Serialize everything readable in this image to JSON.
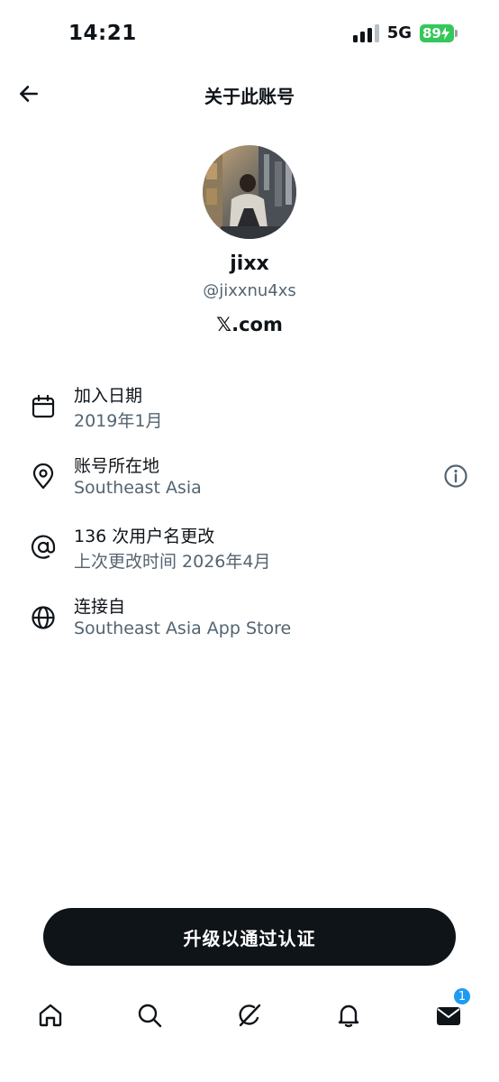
{
  "status_bar": {
    "time": "14:21",
    "network": "5G",
    "battery": "89"
  },
  "header": {
    "title": "关于此账号",
    "back_icon": "arrow-left-icon"
  },
  "profile": {
    "display_name": "jixx",
    "handle": "@jixxnu4xs",
    "site": "𝕏.com"
  },
  "info": [
    {
      "icon": "calendar-icon",
      "label": "加入日期",
      "value": "2019年1月"
    },
    {
      "icon": "location-pin-icon",
      "label": "账号所在地",
      "value": "Southeast Asia",
      "extra_icon": "info-circle-icon"
    },
    {
      "icon": "at-sign-icon",
      "label": "136 次用户名更改",
      "value": "上次更改时间 2026年4月"
    },
    {
      "icon": "globe-icon",
      "label": "连接自",
      "value": "Southeast Asia App Store"
    }
  ],
  "cta": {
    "label": "升级以通过认证"
  },
  "nav": {
    "items": [
      "home-icon",
      "search-icon",
      "grok-icon",
      "bell-icon",
      "envelope-icon"
    ],
    "messages_badge": "1"
  },
  "colors": {
    "text": "#0f1419",
    "muted": "#536471",
    "accent": "#1d9bf0",
    "battery": "#34c759"
  }
}
